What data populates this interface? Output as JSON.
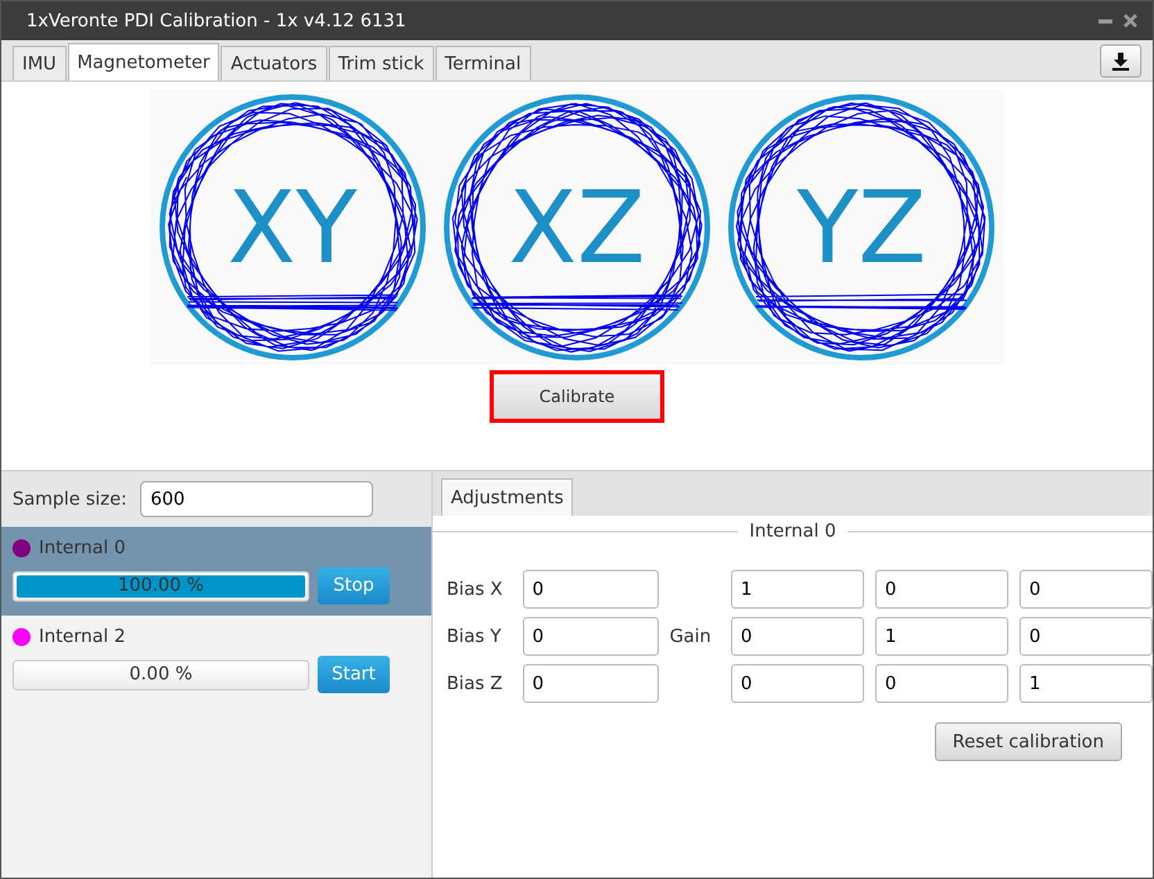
{
  "window": {
    "title": "1xVeronte PDI Calibration - 1x v4.12 6131"
  },
  "tabs": [
    {
      "label": "IMU",
      "selected": false
    },
    {
      "label": "Magnetometer",
      "selected": true
    },
    {
      "label": "Actuators",
      "selected": false
    },
    {
      "label": "Trim stick",
      "selected": false
    },
    {
      "label": "Terminal",
      "selected": false
    }
  ],
  "plots": [
    {
      "label": "XY"
    },
    {
      "label": "XZ"
    },
    {
      "label": "YZ"
    }
  ],
  "calibrate_button": {
    "label": "Calibrate",
    "highlighted": true
  },
  "sample_size": {
    "label": "Sample size:",
    "value": "600"
  },
  "sensors": [
    {
      "name": "Internal 0",
      "color": "#800080",
      "selected": true,
      "level": 1,
      "reading": "100.00 %",
      "action": "Stop"
    },
    {
      "name": "Internal 2",
      "color": "#ff00ff",
      "selected": false,
      "level": 0,
      "reading": "0.00 %",
      "action": "Start"
    }
  ],
  "adjustments": {
    "tab": "Adjustments",
    "group": "Internal 0",
    "bias": [
      {
        "label": "Bias X",
        "value": "0"
      },
      {
        "label": "Bias Y",
        "value": "0"
      },
      {
        "label": "Bias Z",
        "value": "0"
      }
    ],
    "gain_label": "Gain",
    "gain": [
      [
        "1",
        "0",
        "0"
      ],
      [
        "0",
        "1",
        "0"
      ],
      [
        "0",
        "0",
        "1"
      ]
    ],
    "reset_button": "Reset calibration"
  }
}
